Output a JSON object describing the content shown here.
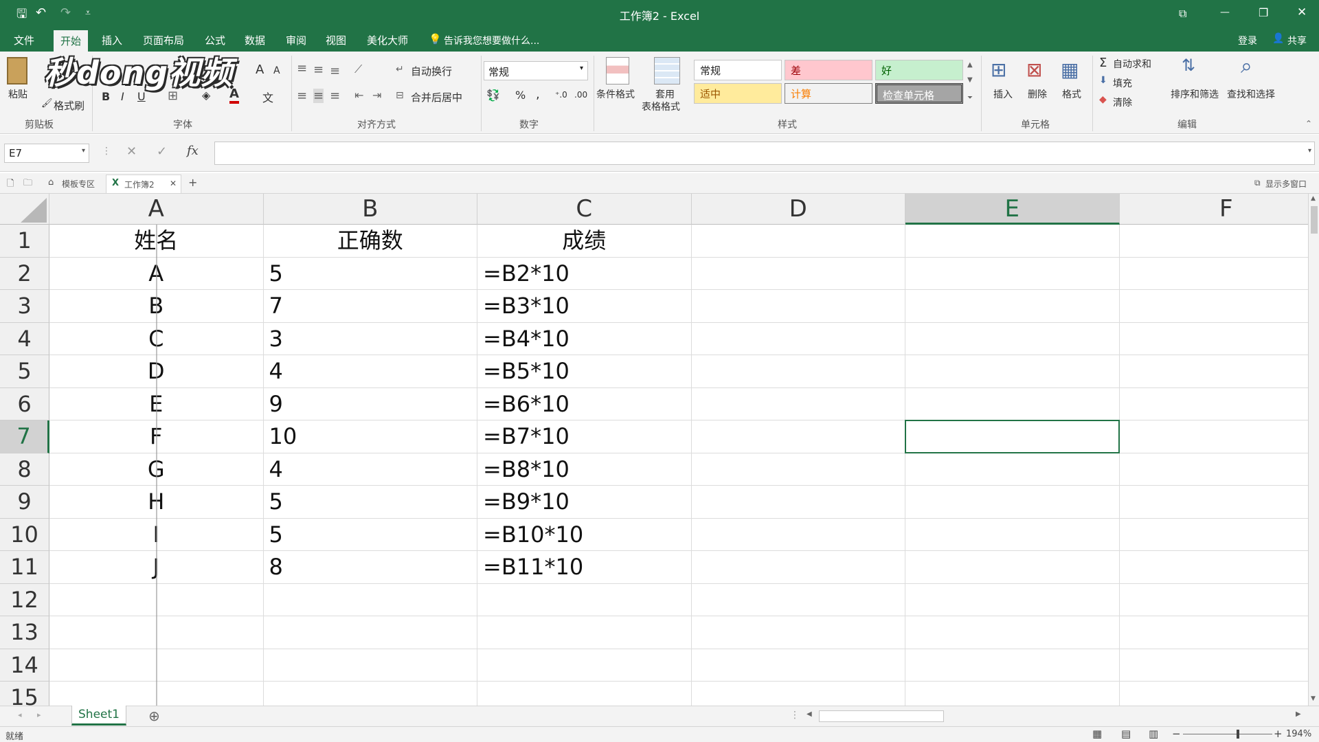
{
  "titlebar": {
    "title": "工作簿2 - Excel",
    "qa_save": "🖫",
    "qa_undo": "↶",
    "qa_redo": "↷",
    "qa_custom": "⩡",
    "win_ribbon_opt": "⧉",
    "win_min": "—",
    "win_max": "❐",
    "win_close": "✕"
  },
  "menu": {
    "items": [
      "文件",
      "开始",
      "插入",
      "页面布局",
      "公式",
      "数据",
      "审阅",
      "视图",
      "美化大师"
    ],
    "tell_me": "告诉我您想要做什么...",
    "login": "登录",
    "share": "共享"
  },
  "ribbon": {
    "clipboard": {
      "paste": "粘贴",
      "format_painter": "格式刷",
      "group": "剪贴板"
    },
    "font": {
      "group": "字体",
      "bold": "B",
      "italic": "I",
      "underline": "U",
      "grow": "A",
      "shrink": "A"
    },
    "align": {
      "wrap": "自动换行",
      "merge": "合并后居中",
      "group": "对齐方式"
    },
    "number": {
      "format": "常规",
      "percent": "%",
      "comma": ",",
      "group": "数字"
    },
    "styles": {
      "conditional": "条件格式",
      "table_fmt_1": "套用",
      "table_fmt_2": "表格格式",
      "normal": "常规",
      "bad": "差",
      "good": "好",
      "neutral": "适中",
      "calc": "计算",
      "check": "检查单元格",
      "group": "样式"
    },
    "cells": {
      "insert": "插入",
      "delete": "删除",
      "format": "格式",
      "group": "单元格"
    },
    "editing": {
      "autosum": "自动求和",
      "fill": "填充",
      "clear": "清除",
      "sort": "排序和筛选",
      "find": "查找和选择",
      "group": "编辑"
    }
  },
  "watermark": "秒dong视频",
  "formula_bar": {
    "name_box": "E7",
    "cancel": "✕",
    "enter": "✓",
    "fx": "fx",
    "content": ""
  },
  "tabs_bar": {
    "template": "模板专区",
    "workbook": "工作簿2",
    "close": "✕",
    "add": "+",
    "multi": "显示多窗口"
  },
  "columns": [
    "A",
    "B",
    "C",
    "D",
    "E",
    "F"
  ],
  "selected_col": "E",
  "selected_row": "7",
  "rows": [
    {
      "n": "1",
      "a": "姓名",
      "b": "正确数",
      "c": "成绩"
    },
    {
      "n": "2",
      "a": "A",
      "b": "5",
      "c": "=B2*10"
    },
    {
      "n": "3",
      "a": "B",
      "b": "7",
      "c": "=B3*10"
    },
    {
      "n": "4",
      "a": "C",
      "b": "3",
      "c": "=B4*10"
    },
    {
      "n": "5",
      "a": "D",
      "b": "4",
      "c": "=B5*10"
    },
    {
      "n": "6",
      "a": "E",
      "b": "9",
      "c": "=B6*10"
    },
    {
      "n": "7",
      "a": "F",
      "b": "10",
      "c": "=B7*10"
    },
    {
      "n": "8",
      "a": "G",
      "b": "4",
      "c": "=B8*10"
    },
    {
      "n": "9",
      "a": "H",
      "b": "5",
      "c": "=B9*10"
    },
    {
      "n": "10",
      "a": "I",
      "b": "5",
      "c": "=B10*10"
    },
    {
      "n": "11",
      "a": "J",
      "b": "8",
      "c": "=B11*10"
    },
    {
      "n": "12",
      "a": "",
      "b": "",
      "c": ""
    },
    {
      "n": "13",
      "a": "",
      "b": "",
      "c": ""
    },
    {
      "n": "14",
      "a": "",
      "b": "",
      "c": ""
    },
    {
      "n": "15",
      "a": "",
      "b": "",
      "c": ""
    }
  ],
  "sheets": {
    "active": "Sheet1",
    "add": "⊕"
  },
  "status": {
    "ready": "就绪",
    "zoom": "194%",
    "minus": "−",
    "plus": "+"
  }
}
